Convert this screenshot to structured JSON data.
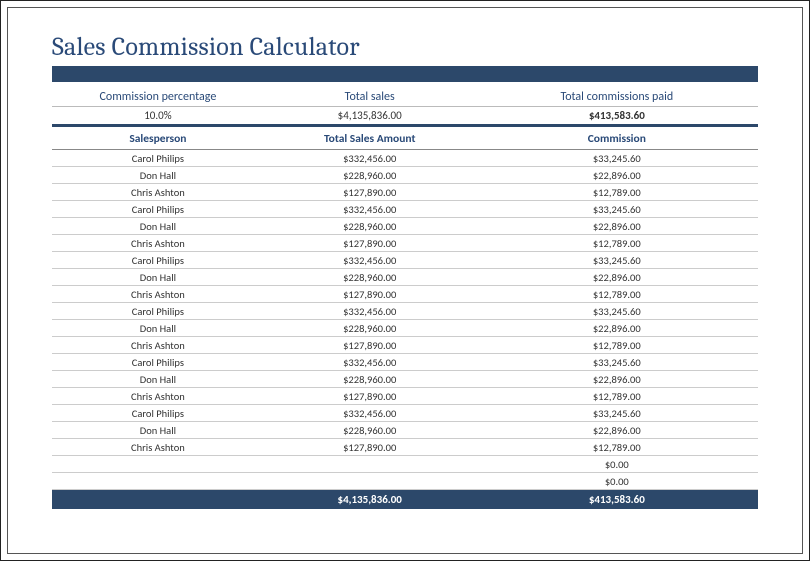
{
  "title": "Sales Commission Calculator",
  "summary": {
    "headers": {
      "pct": "Commission percentage",
      "sales": "Total sales",
      "comm": "Total commissions paid"
    },
    "values": {
      "pct": "10.0%",
      "sales": "$4,135,836.00",
      "comm": "$413,583.60"
    }
  },
  "columns": {
    "person": "Salesperson",
    "amount": "Total Sales Amount",
    "commission": "Commission"
  },
  "rows": [
    {
      "person": "Carol Philips",
      "amount": "$332,456.00",
      "commission": "$33,245.60"
    },
    {
      "person": "Don Hall",
      "amount": "$228,960.00",
      "commission": "$22,896.00"
    },
    {
      "person": "Chris Ashton",
      "amount": "$127,890.00",
      "commission": "$12,789.00"
    },
    {
      "person": "Carol Philips",
      "amount": "$332,456.00",
      "commission": "$33,245.60"
    },
    {
      "person": "Don Hall",
      "amount": "$228,960.00",
      "commission": "$22,896.00"
    },
    {
      "person": "Chris Ashton",
      "amount": "$127,890.00",
      "commission": "$12,789.00"
    },
    {
      "person": "Carol Philips",
      "amount": "$332,456.00",
      "commission": "$33,245.60"
    },
    {
      "person": "Don Hall",
      "amount": "$228,960.00",
      "commission": "$22,896.00"
    },
    {
      "person": "Chris Ashton",
      "amount": "$127,890.00",
      "commission": "$12,789.00"
    },
    {
      "person": "Carol Philips",
      "amount": "$332,456.00",
      "commission": "$33,245.60"
    },
    {
      "person": "Don Hall",
      "amount": "$228,960.00",
      "commission": "$22,896.00"
    },
    {
      "person": "Chris Ashton",
      "amount": "$127,890.00",
      "commission": "$12,789.00"
    },
    {
      "person": "Carol Philips",
      "amount": "$332,456.00",
      "commission": "$33,245.60"
    },
    {
      "person": "Don Hall",
      "amount": "$228,960.00",
      "commission": "$22,896.00"
    },
    {
      "person": "Chris Ashton",
      "amount": "$127,890.00",
      "commission": "$12,789.00"
    },
    {
      "person": "Carol Philips",
      "amount": "$332,456.00",
      "commission": "$33,245.60"
    },
    {
      "person": "Don Hall",
      "amount": "$228,960.00",
      "commission": "$22,896.00"
    },
    {
      "person": "Chris Ashton",
      "amount": "$127,890.00",
      "commission": "$12,789.00"
    },
    {
      "person": "",
      "amount": "",
      "commission": "$0.00"
    },
    {
      "person": "",
      "amount": "",
      "commission": "$0.00"
    }
  ],
  "totals": {
    "amount": "$4,135,836.00",
    "commission": "$413,583.60"
  },
  "chart_data": {
    "type": "table",
    "title": "Sales Commission Calculator",
    "commission_percentage": 10.0,
    "total_sales": 4135836.0,
    "total_commissions_paid": 413583.6,
    "columns": [
      "Salesperson",
      "Total Sales Amount",
      "Commission"
    ],
    "rows": [
      [
        "Carol Philips",
        332456.0,
        33245.6
      ],
      [
        "Don Hall",
        228960.0,
        22896.0
      ],
      [
        "Chris Ashton",
        127890.0,
        12789.0
      ],
      [
        "Carol Philips",
        332456.0,
        33245.6
      ],
      [
        "Don Hall",
        228960.0,
        22896.0
      ],
      [
        "Chris Ashton",
        127890.0,
        12789.0
      ],
      [
        "Carol Philips",
        332456.0,
        33245.6
      ],
      [
        "Don Hall",
        228960.0,
        22896.0
      ],
      [
        "Chris Ashton",
        127890.0,
        12789.0
      ],
      [
        "Carol Philips",
        332456.0,
        33245.6
      ],
      [
        "Don Hall",
        228960.0,
        22896.0
      ],
      [
        "Chris Ashton",
        127890.0,
        12789.0
      ],
      [
        "Carol Philips",
        332456.0,
        33245.6
      ],
      [
        "Don Hall",
        228960.0,
        22896.0
      ],
      [
        "Chris Ashton",
        127890.0,
        12789.0
      ],
      [
        "Carol Philips",
        332456.0,
        33245.6
      ],
      [
        "Don Hall",
        228960.0,
        22896.0
      ],
      [
        "Chris Ashton",
        127890.0,
        12789.0
      ],
      [
        "",
        null,
        0.0
      ],
      [
        "",
        null,
        0.0
      ]
    ],
    "totals": {
      "Total Sales Amount": 4135836.0,
      "Commission": 413583.6
    }
  }
}
